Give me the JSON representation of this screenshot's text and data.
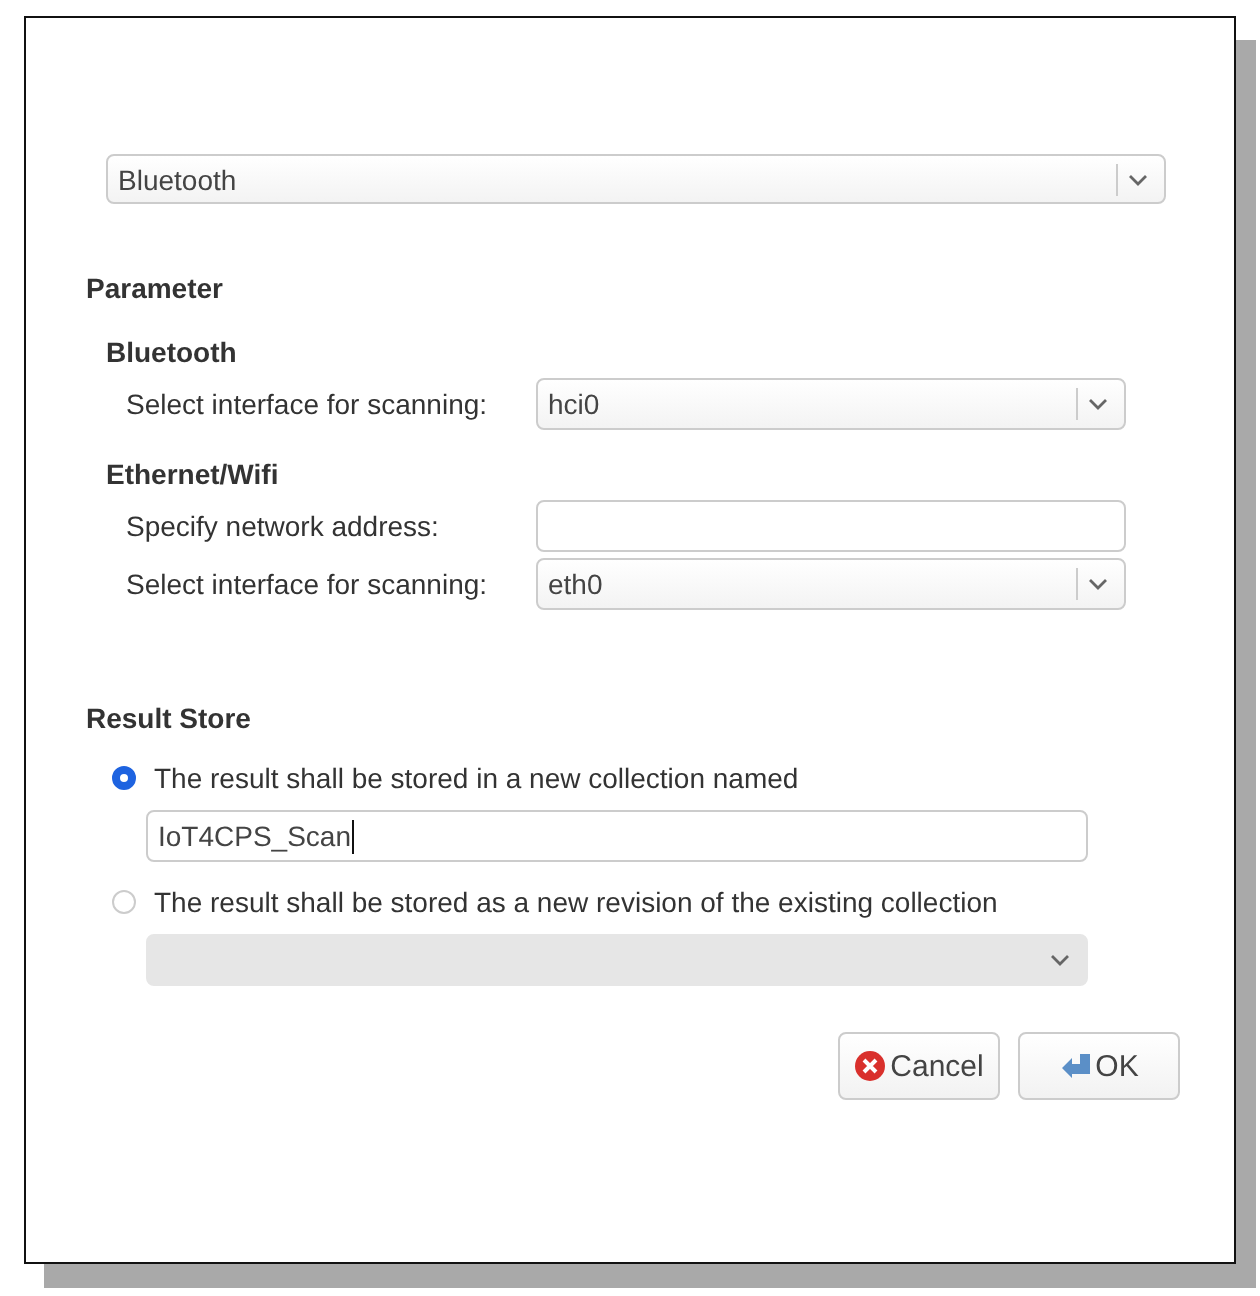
{
  "source_select": {
    "value": "Bluetooth"
  },
  "parameter": {
    "heading": "Parameter",
    "groups": [
      {
        "heading": "Bluetooth",
        "rows": [
          {
            "kind": "select",
            "label": "Select interface for scanning:",
            "value": "hci0"
          }
        ]
      },
      {
        "heading": "Ethernet/Wifi",
        "rows": [
          {
            "kind": "text",
            "label": "Specify network address:"
          },
          {
            "kind": "select",
            "label": "Select interface for scanning:",
            "value": "eth0"
          }
        ]
      }
    ]
  },
  "result_store": {
    "heading": "Result Store",
    "options": [
      {
        "label": "The result shall be stored in a new collection named",
        "selected": true,
        "field": {
          "kind": "text",
          "value": "IoT4CPS_Scan",
          "focused": true,
          "disabled": false
        }
      },
      {
        "label": "The result shall be stored as a new revision of the existing collection",
        "selected": false,
        "field": {
          "kind": "select",
          "focused": false,
          "disabled": true
        }
      }
    ]
  },
  "buttons": [
    {
      "kind": "cancel",
      "label": "Cancel"
    },
    {
      "kind": "ok",
      "label": "OK"
    }
  ]
}
